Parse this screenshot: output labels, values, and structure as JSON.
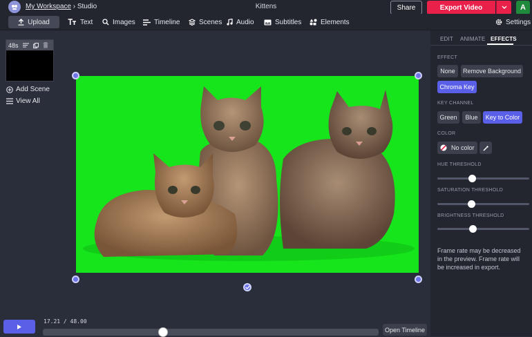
{
  "header": {
    "workspace": "My Workspace",
    "separator": " › ",
    "section": "Studio",
    "title": "Kittens",
    "share_label": "Share",
    "export_label": "Export Video",
    "avatar_letter": "A"
  },
  "toolbar": {
    "upload": "Upload",
    "text": "Text",
    "images": "Images",
    "timeline": "Timeline",
    "scenes": "Scenes",
    "audio": "Audio",
    "subtitles": "Subtitles",
    "elements": "Elements",
    "settings": "Settings"
  },
  "scenes": {
    "card_duration": "48s",
    "add_scene": "Add Scene",
    "view_all": "View All"
  },
  "panel": {
    "tabs": [
      "EDIT",
      "ANIMATE",
      "EFFECTS"
    ],
    "effect_label": "EFFECT",
    "effect_options": [
      "None",
      "Remove Background",
      "Chroma Key"
    ],
    "effect_selected": "Chroma Key",
    "key_channel_label": "KEY CHANNEL",
    "key_channel_options": [
      "Green",
      "Blue",
      "Key to Color"
    ],
    "key_channel_selected": "Key to Color",
    "color_label": "COLOR",
    "color_value": "No color",
    "hue_label": "HUE THRESHOLD",
    "hue_value": 0.38,
    "saturation_label": "SATURATION THRESHOLD",
    "saturation_value": 0.37,
    "brightness_label": "BRIGHTNESS THRESHOLD",
    "brightness_value": 0.39,
    "note": "Frame rate may be decreased in the preview. Frame rate will be increased in export."
  },
  "playback": {
    "current": "17.21",
    "separator": " / ",
    "total": "48.00",
    "progress": 0.3586,
    "open_timeline": "Open Timeline"
  },
  "colors": {
    "accent": "#5a5fe8",
    "export": "#e8204a",
    "green_screen": "#15e51a",
    "avatar": "#1f8a3c"
  }
}
